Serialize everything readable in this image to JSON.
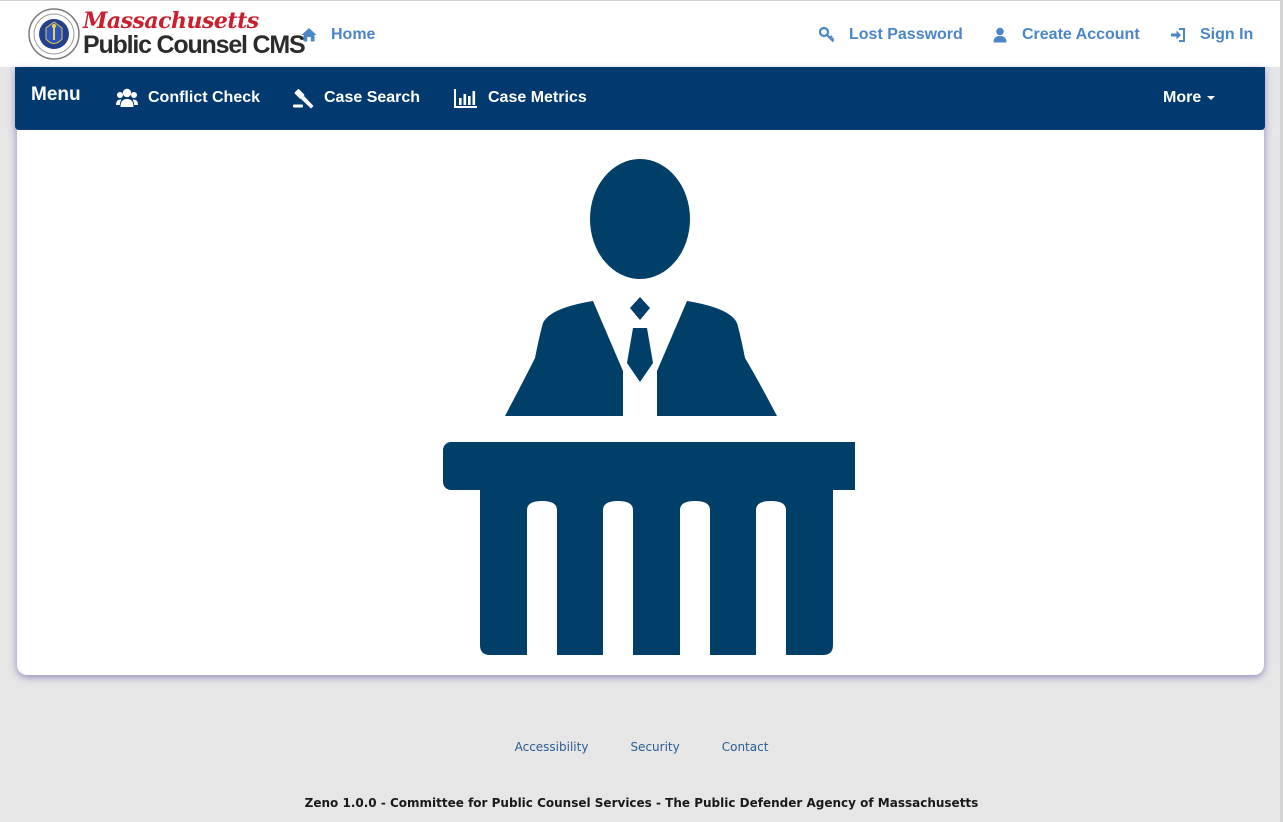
{
  "header": {
    "logo_line1": "Massachusetts",
    "logo_line2": "Public Counsel CMS",
    "home_label": "Home",
    "lost_password_label": "Lost Password",
    "create_account_label": "Create Account",
    "sign_in_label": "Sign In"
  },
  "navbar": {
    "menu_label": "Menu",
    "items": [
      {
        "label": "Conflict Check",
        "icon": "users-icon"
      },
      {
        "label": "Case Search",
        "icon": "gavel-icon"
      },
      {
        "label": "Case Metrics",
        "icon": "bar-chart-icon"
      }
    ],
    "more_label": "More"
  },
  "hero": {
    "icon": "attorney-at-podium-icon"
  },
  "footer": {
    "links": [
      "Accessibility",
      "Security",
      "Contact"
    ],
    "text": "Zeno 1.0.0 - Committee for Public Counsel Services - The Public Defender Agency of Massachusetts"
  },
  "colors": {
    "navbar_bg": "#023a70",
    "link_blue": "#4b86c8",
    "hero_icon": "#003f68",
    "logo_red": "#cc1f2d"
  }
}
